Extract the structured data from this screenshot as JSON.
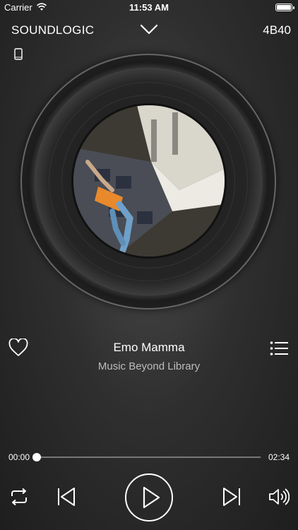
{
  "status_bar": {
    "carrier": "Carrier",
    "time": "11:53 AM"
  },
  "header": {
    "brand": "SOUNDLOGIC",
    "device_model": "4B40"
  },
  "now_playing": {
    "title": "Emo Mamma",
    "artist": "Music Beyond Library",
    "favorited": false
  },
  "progress": {
    "elapsed": "00:00",
    "total": "02:34",
    "fraction": 0.0
  },
  "icons": {
    "wifi": "wifi-icon",
    "battery": "battery-icon",
    "collapse": "chevron-down-icon",
    "device": "phone-icon",
    "favorite": "heart-icon",
    "playlist": "list-icon",
    "repeat": "repeat-icon",
    "previous": "previous-track-icon",
    "play": "play-icon",
    "next": "next-track-icon",
    "volume": "volume-icon"
  },
  "colors": {
    "text": "#ffffff",
    "secondary_text": "#bdbdbd",
    "track": "#777777"
  }
}
